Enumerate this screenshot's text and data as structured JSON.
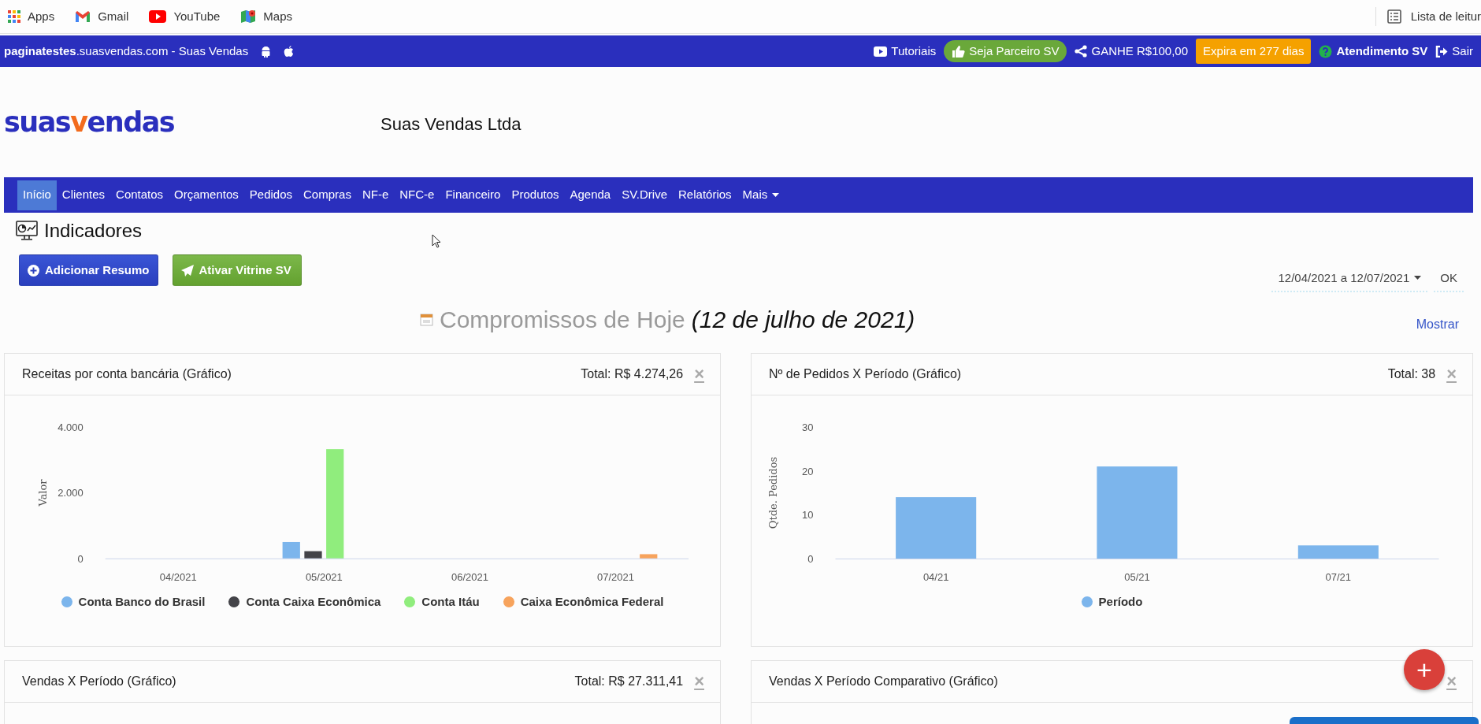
{
  "bookmarks": [
    {
      "kind": "apps",
      "label": "Apps"
    },
    {
      "kind": "gmail",
      "label": "Gmail"
    },
    {
      "kind": "youtube",
      "label": "YouTube"
    },
    {
      "kind": "maps",
      "label": "Maps"
    }
  ],
  "reading_list": "Lista de leitur",
  "top_bar": {
    "site": "**paginatestes**.suasvendas.com - Suas Vendas",
    "links": [
      {
        "kind": "tutorials",
        "label": "Tutoriais"
      },
      {
        "kind": "partner",
        "label": "Seja Parceiro SV"
      },
      {
        "kind": "share",
        "label": "GANHE R$100,00"
      },
      {
        "kind": "expiry",
        "label": "Expira em 277 dias"
      },
      {
        "kind": "support",
        "label": "Atendimento SV"
      },
      {
        "kind": "logout",
        "label": "Sair"
      }
    ]
  },
  "logo": [
    {
      "text": "suas",
      "color": "#2a2fbd"
    },
    {
      "text": "v",
      "color": "#f26b1d"
    },
    {
      "text": "endas",
      "color": "#2a2fbd"
    }
  ],
  "company": "Suas Vendas Ltda",
  "nav": [
    {
      "label": "Início",
      "selected": true,
      "dropdown": false
    },
    {
      "label": "Clientes",
      "selected": false,
      "dropdown": false
    },
    {
      "label": "Contatos",
      "selected": false,
      "dropdown": false
    },
    {
      "label": "Orçamentos",
      "selected": false,
      "dropdown": false
    },
    {
      "label": "Pedidos",
      "selected": false,
      "dropdown": false
    },
    {
      "label": "Compras",
      "selected": false,
      "dropdown": false
    },
    {
      "label": "NF-e",
      "selected": false,
      "dropdown": false
    },
    {
      "label": "NFC-e",
      "selected": false,
      "dropdown": false
    },
    {
      "label": "Financeiro",
      "selected": false,
      "dropdown": false
    },
    {
      "label": "Produtos",
      "selected": false,
      "dropdown": false
    },
    {
      "label": "Agenda",
      "selected": false,
      "dropdown": false
    },
    {
      "label": "SV.Drive",
      "selected": false,
      "dropdown": false
    },
    {
      "label": "Relatórios",
      "selected": false,
      "dropdown": false
    },
    {
      "label": "Mais",
      "selected": false,
      "dropdown": true
    }
  ],
  "page_title": "Indicadores",
  "actions": [
    {
      "kind": "add",
      "label": "Adicionar Resumo"
    },
    {
      "kind": "send",
      "label": "Ativar Vitrine SV"
    }
  ],
  "date_range": "12/04/2021 a 12/07/2021",
  "ok": "OK",
  "agenda": {
    "title": "Compromissos de Hoje",
    "date": "(12 de julho de 2021)",
    "toggle": "Mostrar"
  },
  "cards": [
    {
      "title": "Receitas por conta bancária (Gráfico)",
      "total": "Total: R$ 4.274,26",
      "close": "×",
      "chart_data": {
        "type": "bar",
        "legend": "bottom",
        "ylabel": "Valor",
        "categories": [
          "04/2021",
          "05/2021",
          "06/2021",
          "07/2021"
        ],
        "ylim": [
          0,
          4000
        ],
        "yticks": [
          {
            "value": 0,
            "label": "0"
          },
          {
            "value": 2000,
            "label": "2.000"
          },
          {
            "value": 4000,
            "label": "4.000"
          }
        ],
        "series": [
          {
            "name": "Conta Banco do Brasil",
            "color": "#7cb5ec",
            "values": [
              null,
              500,
              null,
              null
            ]
          },
          {
            "name": "Conta Caixa Econômica",
            "color": "#434348",
            "values": [
              null,
              220,
              null,
              null
            ]
          },
          {
            "name": "Conta Itáu",
            "color": "#90ed7d",
            "values": [
              null,
              3330,
              null,
              null
            ]
          },
          {
            "name": "Caixa Econômica Federal",
            "color": "#f7a35c",
            "values": [
              null,
              null,
              null,
              130
            ]
          }
        ]
      }
    },
    {
      "title": "Nº de Pedidos X Período (Gráfico)",
      "total": "Total: 38",
      "close": "×",
      "chart_data": {
        "type": "bar",
        "legend": "bottom",
        "ylabel": "Qtde. Pedidos",
        "categories": [
          "04/21",
          "05/21",
          "07/21"
        ],
        "ylim": [
          0,
          30
        ],
        "yticks": [
          0,
          10,
          20,
          30
        ],
        "series": [
          {
            "name": "Período",
            "color": "#7cb5ec",
            "values": [
              14,
              21,
              3
            ]
          }
        ]
      }
    },
    {
      "title": "Vendas X Período (Gráfico)",
      "total": "Total: R$ 27.311,41",
      "close": "×"
    },
    {
      "title": "Vendas X Período Comparativo (Gráfico)",
      "close": "×"
    }
  ],
  "fab": "+"
}
